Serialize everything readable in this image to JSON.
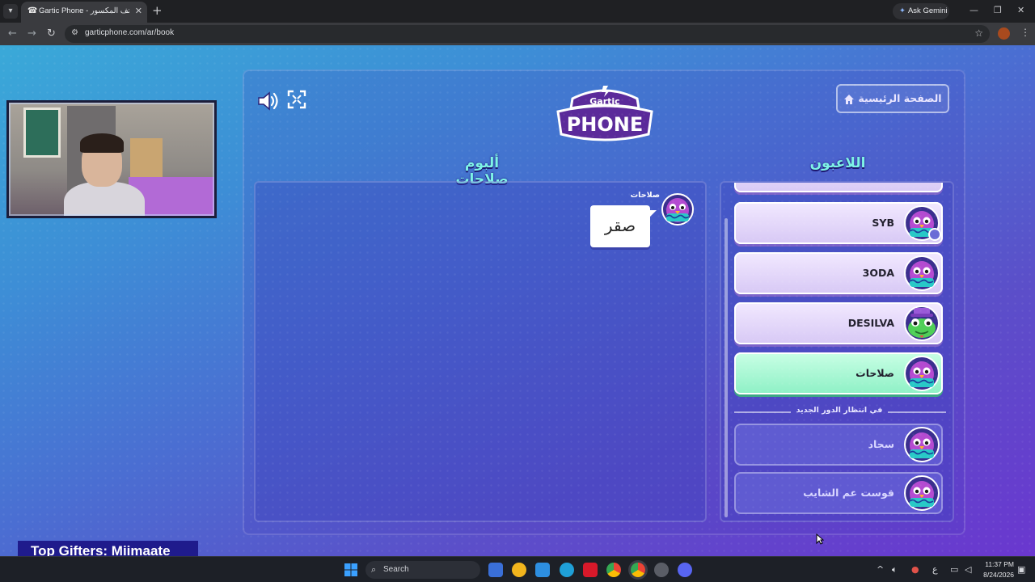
{
  "browser": {
    "tab_title": "Gartic Phone - الهاتف المكسور",
    "new_tab": "+",
    "ask_gemini": "Ask Gemini",
    "url": "garticphone.com/ar/book",
    "icons": [
      "tab-list-icon",
      "tab-favicon-icon",
      "close-icon",
      "back-icon",
      "forward-icon",
      "reload-icon",
      "site-info-icon",
      "star-icon",
      "profile-icon",
      "menu-icon",
      "minimize-icon",
      "restore-icon"
    ]
  },
  "game": {
    "logo_top": "Gartic",
    "logo_main": "PHONE",
    "home_button": "الصفحة الرئيسية",
    "album_heading": "ألبوم صلاحات",
    "players_heading": "اللاعبون",
    "album": {
      "author": "صلاحات",
      "text": "صقر"
    },
    "players": [
      {
        "name": "SYB",
        "state": "active",
        "host": true,
        "avatar": "purple-bird"
      },
      {
        "name": "3ODA",
        "state": "active",
        "host": false,
        "avatar": "purple-bird"
      },
      {
        "name": "DESILVA",
        "state": "active",
        "host": false,
        "avatar": "green-frog-hat"
      },
      {
        "name": "صلاحات",
        "state": "me",
        "host": false,
        "avatar": "purple-bird"
      }
    ],
    "waiting_label": "في انتظار الدور الجديد",
    "waiting_players": [
      {
        "name": "سجاد",
        "avatar": "purple-bird"
      },
      {
        "name": "قوست عم الشايب",
        "avatar": "purple-bird"
      }
    ]
  },
  "overlay": {
    "top_gifters": "Top Gifters: Miimaate"
  },
  "taskbar": {
    "search": "Search",
    "ime": "ع",
    "time": "11:37 PM",
    "date": "8/24/2026"
  },
  "colors": {
    "accent_heading": "#7df3e6",
    "player_card": "#e6daff",
    "me_card": "#9ff4cf",
    "bubble": "#ffffff"
  }
}
